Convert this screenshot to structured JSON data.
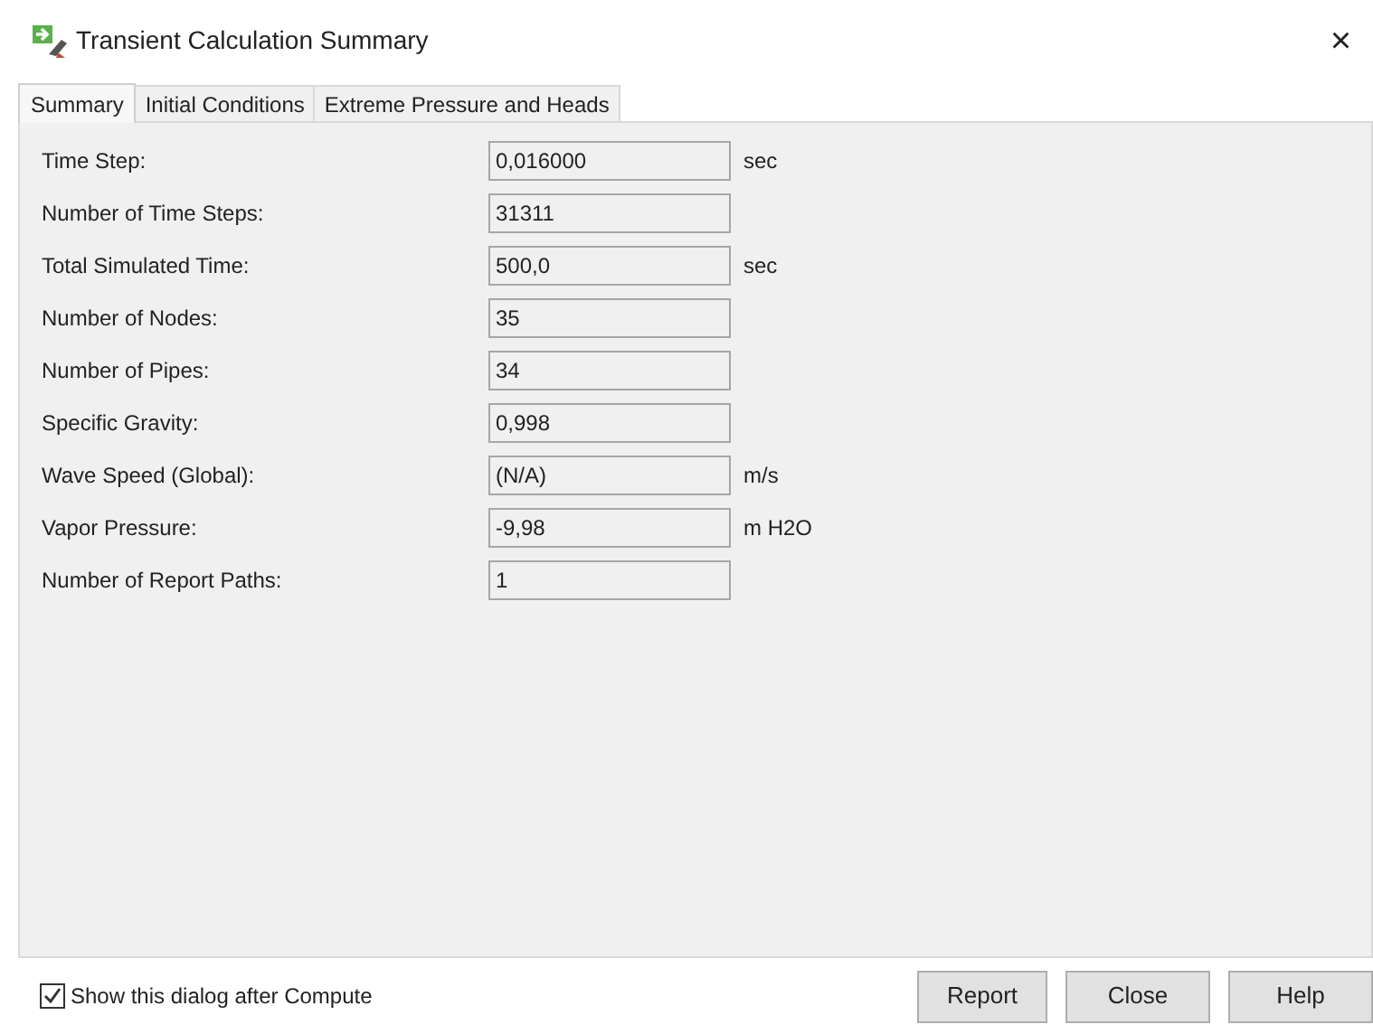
{
  "window": {
    "title": "Transient Calculation Summary",
    "close": "×"
  },
  "tabs": [
    {
      "label": "Summary",
      "selected": true
    },
    {
      "label": "Initial Conditions",
      "selected": false
    },
    {
      "label": "Extreme Pressure and Heads",
      "selected": false
    }
  ],
  "fields": [
    {
      "label": "Time Step:",
      "value": "0,016000",
      "unit": "sec"
    },
    {
      "label": "Number of Time Steps:",
      "value": "31311"
    },
    {
      "label": "Total Simulated Time:",
      "value": "500,0",
      "unit": "sec"
    },
    {
      "label": "Number of Nodes:",
      "value": "35"
    },
    {
      "label": "Number of Pipes:",
      "value": "34"
    },
    {
      "label": "Specific Gravity:",
      "value": "0,998"
    },
    {
      "label": "Wave Speed (Global):",
      "value": "(N/A)",
      "unit": "m/s"
    },
    {
      "label": "Vapor Pressure:",
      "value": "-9,98",
      "unit": "m H2O"
    },
    {
      "label": "Number of Report Paths:",
      "value": "1"
    }
  ],
  "show_after_compute": {
    "label": "Show this dialog after Compute",
    "checked": true
  },
  "buttons": [
    "Report",
    "Close",
    "Help"
  ]
}
